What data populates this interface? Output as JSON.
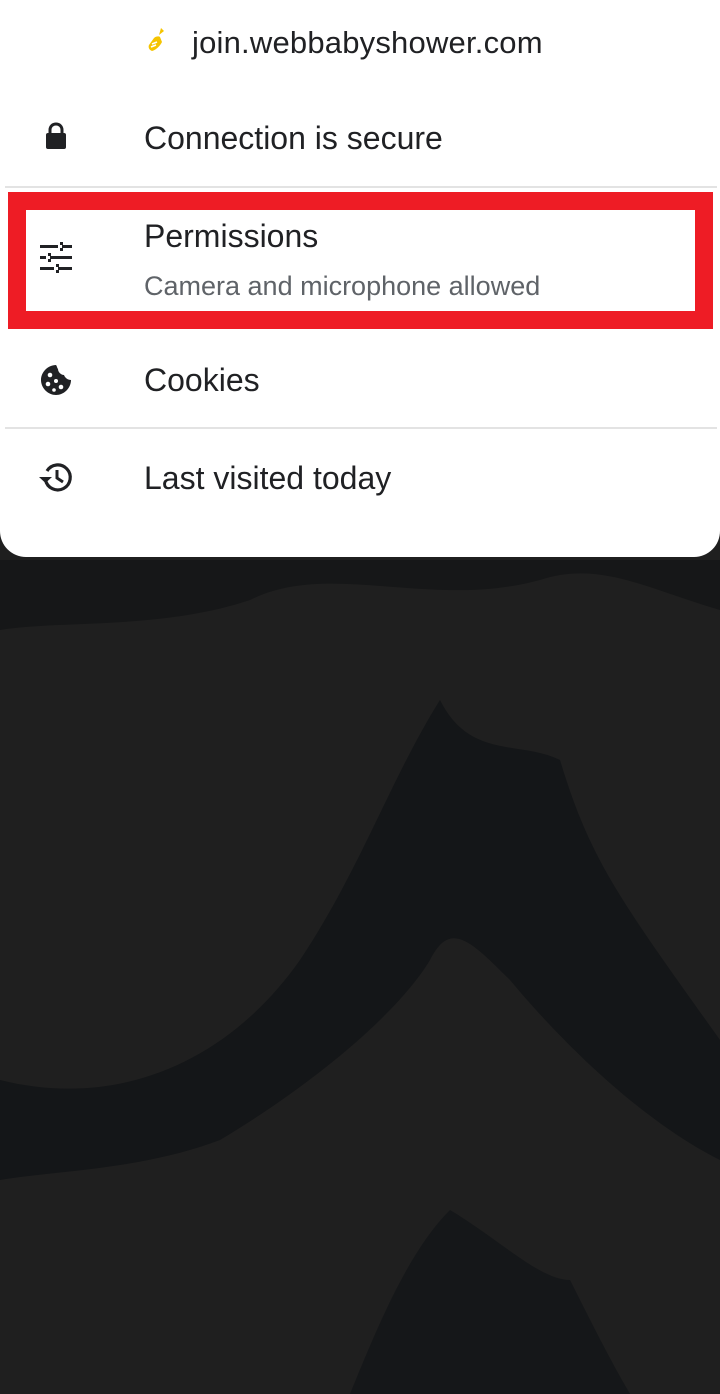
{
  "site": {
    "url": "join.webbabyshower.com",
    "favicon": "baby-bottle-icon"
  },
  "rows": [
    {
      "name": "connection",
      "title": "Connection is secure",
      "icon": "lock-icon"
    },
    {
      "name": "permissions",
      "title": "Permissions",
      "subtitle": "Camera and microphone allowed",
      "icon": "tune-sliders-icon"
    },
    {
      "name": "cookies",
      "title": "Cookies",
      "icon": "cookie-icon"
    },
    {
      "name": "history",
      "title": "Last visited today",
      "icon": "history-icon"
    }
  ],
  "colors": {
    "sheet": "#ffffff",
    "text": "#202124",
    "secondary_text": "#5f6368",
    "highlight": "#ee1c25",
    "backdrop": "#1f1f1f",
    "favicon": "#f5c400"
  }
}
